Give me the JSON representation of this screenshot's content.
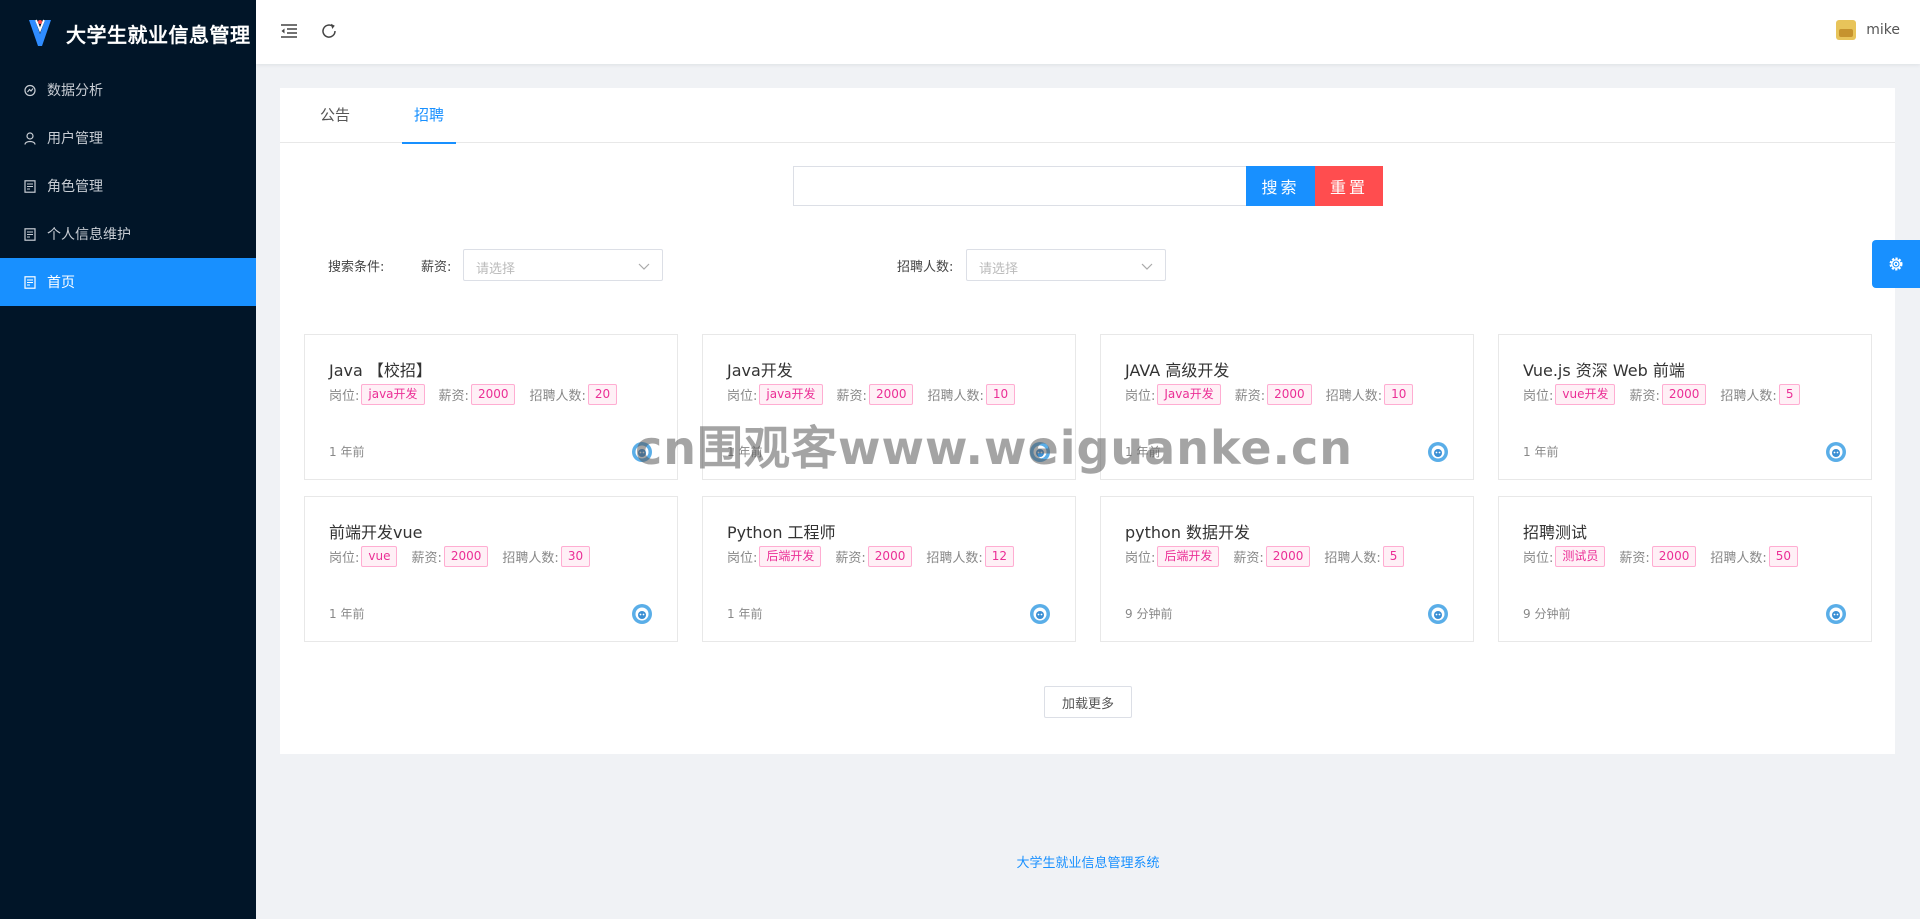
{
  "app": {
    "title": "大学生就业信息管理",
    "footer": "大学生就业信息管理系统"
  },
  "sidebar": {
    "items": [
      {
        "label": "数据分析",
        "icon": "chart-icon",
        "active": false
      },
      {
        "label": "用户管理",
        "icon": "user-icon",
        "active": false
      },
      {
        "label": "角色管理",
        "icon": "document-icon",
        "active": false
      },
      {
        "label": "个人信息维护",
        "icon": "document-icon",
        "active": false
      },
      {
        "label": "首页",
        "icon": "document-icon",
        "active": true
      }
    ]
  },
  "header": {
    "username": "mike"
  },
  "tabs": [
    {
      "label": "公告",
      "active": false
    },
    {
      "label": "招聘",
      "active": true
    }
  ],
  "search": {
    "value": "",
    "placeholder": "",
    "search_label": "搜索",
    "reset_label": "重置"
  },
  "filters": {
    "title": "搜索条件:",
    "salary_label": "薪资:",
    "salary_placeholder": "请选择",
    "count_label": "招聘人数:",
    "count_placeholder": "请选择"
  },
  "labels": {
    "position": "岗位:",
    "salary": "薪资:",
    "count": "招聘人数:"
  },
  "jobs": [
    {
      "title": "Java 【校招】",
      "position": "java开发",
      "salary": "2000",
      "count": "20",
      "time": "1 年前"
    },
    {
      "title": "Java开发",
      "position": "java开发",
      "salary": "2000",
      "count": "10",
      "time": "1 年前"
    },
    {
      "title": "JAVA 高级开发",
      "position": "Java开发",
      "salary": "2000",
      "count": "10",
      "time": "1 年前"
    },
    {
      "title": "Vue.js 资深 Web 前端",
      "position": "vue开发",
      "salary": "2000",
      "count": "5",
      "time": "1 年前"
    },
    {
      "title": "前端开发vue",
      "position": "vue",
      "salary": "2000",
      "count": "30",
      "time": "1 年前"
    },
    {
      "title": "Python 工程师",
      "position": "后端开发",
      "salary": "2000",
      "count": "12",
      "time": "1 年前"
    },
    {
      "title": "python 数据开发",
      "position": "后端开发",
      "salary": "2000",
      "count": "5",
      "time": "9 分钟前"
    },
    {
      "title": "招聘测试",
      "position": "测试员",
      "salary": "2000",
      "count": "50",
      "time": "9 分钟前"
    }
  ],
  "load_more": "加载更多",
  "watermark": "cn围观客www.weiguanke.cn",
  "colors": {
    "sidebar_bg": "#011528",
    "accent": "#1890ff",
    "reset": "#ff4d4f",
    "tag": "#eb2f96"
  }
}
